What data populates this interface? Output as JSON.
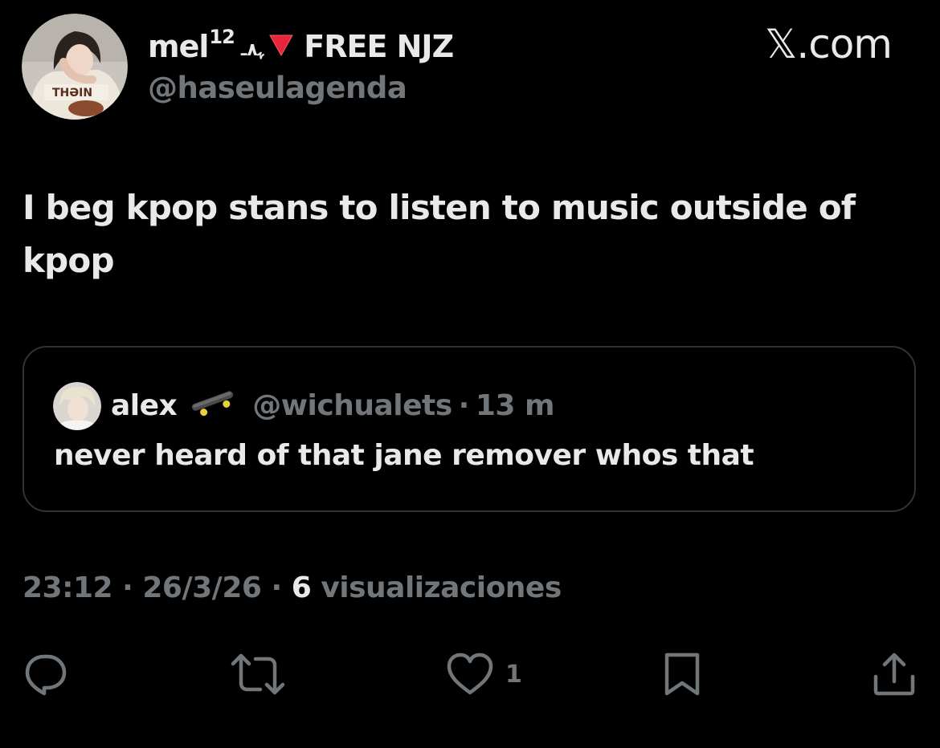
{
  "author": {
    "display_name": "mel",
    "name_superscript": "12",
    "name_decoration": "ﮩ٨ـ",
    "name_tag": "FREE NJZ",
    "handle": "@haseulagenda",
    "avatar_icon": "profile-photo"
  },
  "brand": {
    "label": "𝕏.com"
  },
  "tweet": {
    "text": "I beg kpop stans to listen to music outside of kpop"
  },
  "quoted_tweet": {
    "name": "alex",
    "emoji": "skateboard",
    "handle": "@wichualets",
    "separator": "·",
    "time": "13 m",
    "text": "never heard of that jane remover whos that",
    "avatar_icon": "profile-photo"
  },
  "meta": {
    "time": "23:12",
    "separator": "·",
    "date": "26/3/26",
    "views_count": "6",
    "views_label": "visualizaciones"
  },
  "actions": {
    "reply_icon": "reply-icon",
    "repost_icon": "repost-icon",
    "like_icon": "heart-icon",
    "like_count": "1",
    "bookmark_icon": "bookmark-icon",
    "share_icon": "share-icon"
  },
  "colors": {
    "background": "#000000",
    "text_primary": "#e7e9ea",
    "text_secondary": "#71767b",
    "border": "#2f3336",
    "red_triangle": "#e8253a"
  }
}
